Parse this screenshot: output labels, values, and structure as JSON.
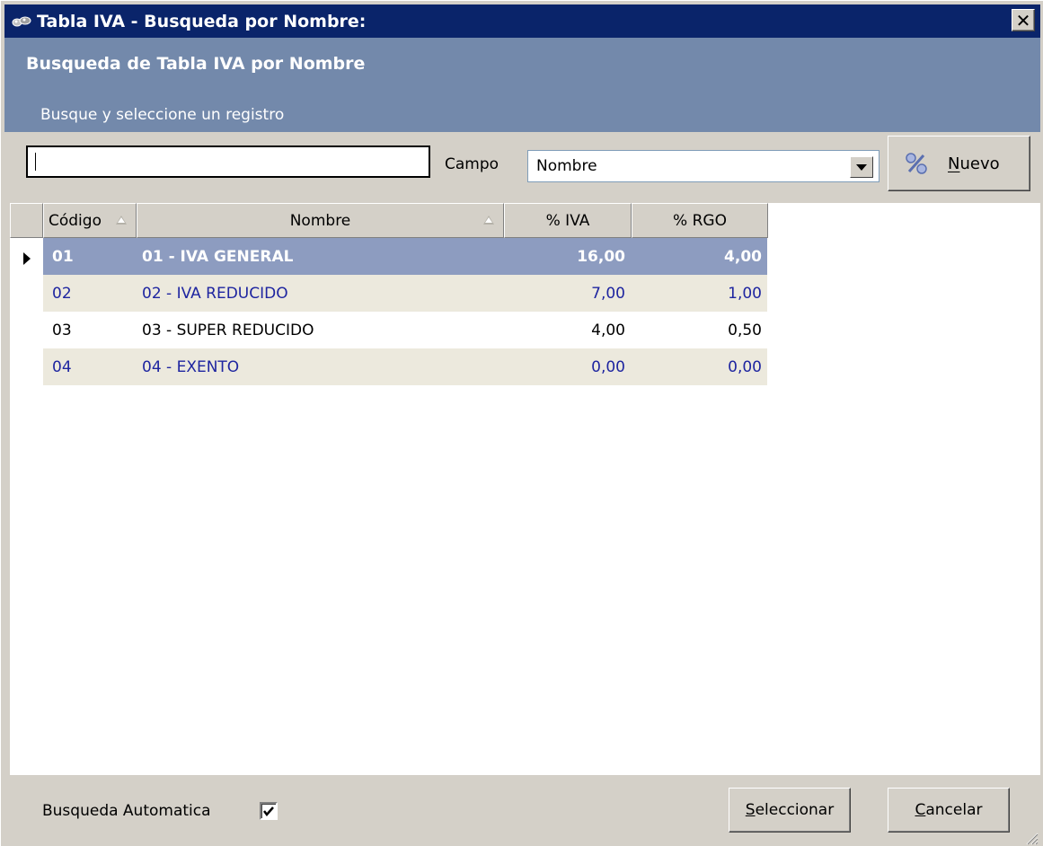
{
  "window": {
    "title": "Tabla IVA - Busqueda por Nombre:",
    "close_glyph": "✕"
  },
  "header": {
    "title": "Busqueda de Tabla IVA por Nombre",
    "subtitle": "Busque y seleccione un registro"
  },
  "search": {
    "value": "",
    "field_label": "Campo",
    "field_value": "Nombre",
    "new_button": {
      "accel": "N",
      "rest": "uevo"
    }
  },
  "grid": {
    "columns": [
      {
        "label": "Código",
        "sortable": true
      },
      {
        "label": "Nombre",
        "sortable": true
      },
      {
        "label": "% IVA",
        "sortable": false
      },
      {
        "label": "% RGO",
        "sortable": false
      }
    ],
    "rows": [
      {
        "codigo": "01",
        "nombre": "01 - IVA GENERAL",
        "iva": "16,00",
        "rgo": "4,00",
        "selected": true
      },
      {
        "codigo": "02",
        "nombre": "02 - IVA REDUCIDO",
        "iva": "7,00",
        "rgo": "1,00",
        "selected": false
      },
      {
        "codigo": "03",
        "nombre": "03 - SUPER REDUCIDO",
        "iva": "4,00",
        "rgo": "0,50",
        "selected": false
      },
      {
        "codigo": "04",
        "nombre": "04 - EXENTO",
        "iva": "0,00",
        "rgo": "0,00",
        "selected": false
      }
    ]
  },
  "footer": {
    "auto_search_label": "Busqueda Automatica",
    "auto_search_checked": true,
    "select_button": {
      "accel": "S",
      "rest": "eleccionar"
    },
    "cancel_button": {
      "accel": "C",
      "rest": "ancelar"
    }
  },
  "colors": {
    "titlebar": "#0a246a",
    "header_band": "#7389ab",
    "selected_row": "#8d9cc0",
    "alt_row": "#ece9dd",
    "alt_text": "#1e25a0"
  }
}
